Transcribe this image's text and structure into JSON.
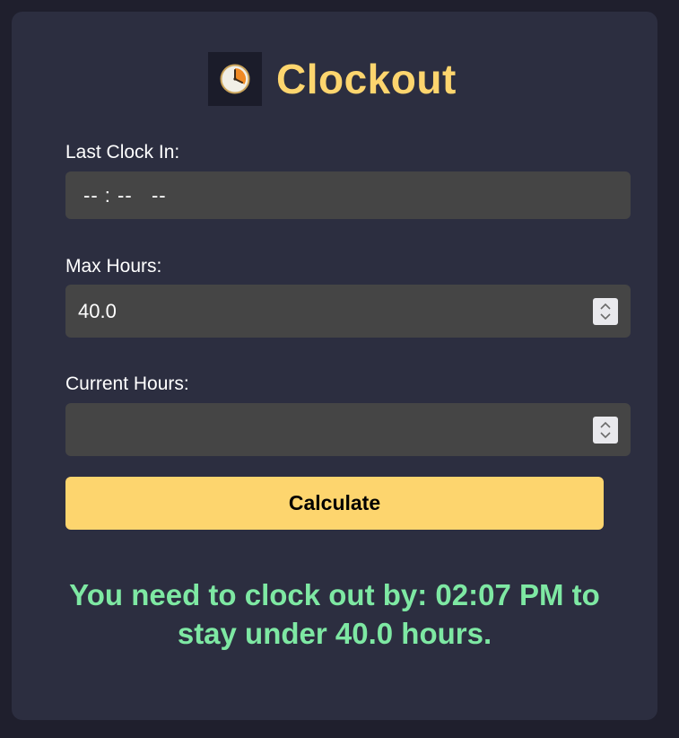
{
  "app": {
    "title": "Clockout",
    "logo_icon": "clock-icon",
    "accent_color": "#fdd56e",
    "result_color": "#7ee8a3"
  },
  "form": {
    "last_clock_in": {
      "label": "Last Clock In:",
      "value": "-- : --   --"
    },
    "max_hours": {
      "label": "Max Hours:",
      "value": "40.0"
    },
    "current_hours": {
      "label": "Current Hours:",
      "value": ""
    },
    "calculate_label": "Calculate"
  },
  "result": {
    "message": "You need to clock out by: 02:07 PM to stay under 40.0 hours."
  }
}
